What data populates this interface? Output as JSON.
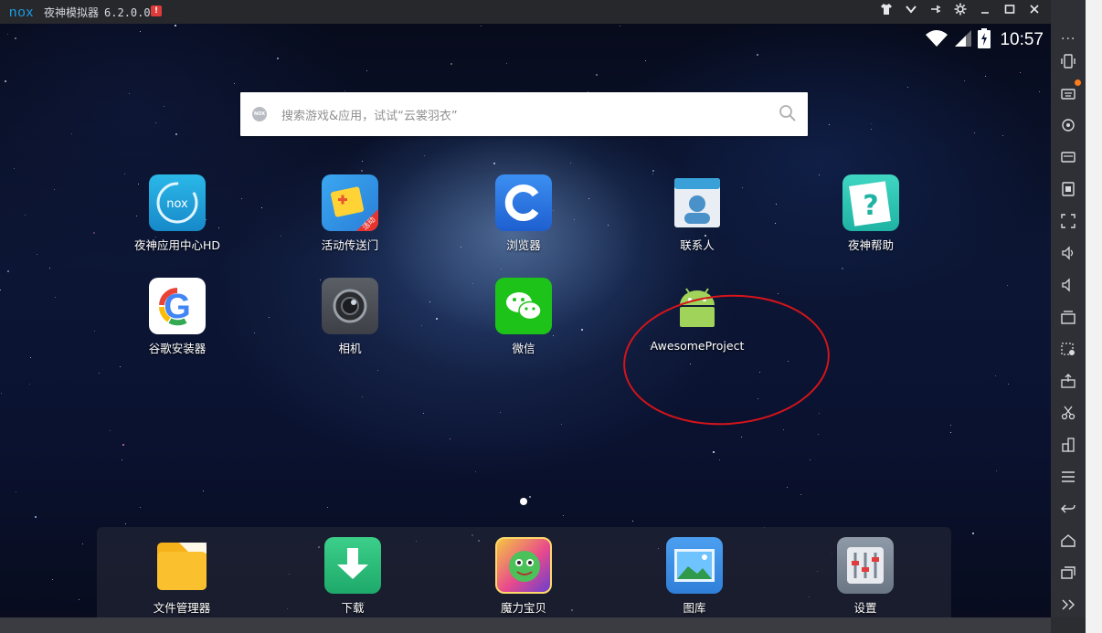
{
  "window": {
    "logo": "nox",
    "title": "夜神模拟器",
    "version": "6.2.0.0",
    "alert_badge": "!",
    "controls": [
      "shirt-icon",
      "chevron-down-icon",
      "pin-icon",
      "gear-icon",
      "minimize-icon",
      "maximize-icon",
      "close-icon"
    ]
  },
  "status": {
    "time": "10:57",
    "icons": [
      "wifi-icon",
      "signal-icon",
      "battery-charging-icon"
    ]
  },
  "search": {
    "badge": "NOX",
    "placeholder": "搜索游戏&应用，试试“云裳羽衣”"
  },
  "apps": [
    {
      "label": "夜神应用中心HD",
      "icon": "nox-app-center-icon"
    },
    {
      "label": "活动传送门",
      "icon": "event-portal-icon",
      "tag": "活动"
    },
    {
      "label": "浏览器",
      "icon": "browser-icon"
    },
    {
      "label": "联系人",
      "icon": "contacts-icon"
    },
    {
      "label": "夜神帮助",
      "icon": "help-icon"
    },
    {
      "label": "谷歌安装器",
      "icon": "google-installer-icon"
    },
    {
      "label": "相机",
      "icon": "camera-icon"
    },
    {
      "label": "微信",
      "icon": "wechat-icon"
    },
    {
      "label": "AwesomeProject",
      "icon": "android-icon"
    }
  ],
  "dock": [
    {
      "label": "文件管理器",
      "icon": "folder-icon"
    },
    {
      "label": "下载",
      "icon": "download-icon"
    },
    {
      "label": "魔力宝贝",
      "icon": "game-icon"
    },
    {
      "label": "图库",
      "icon": "gallery-icon"
    },
    {
      "label": "设置",
      "icon": "settings-icon"
    }
  ],
  "sidebar": {
    "more": "···",
    "tools": [
      "shake-icon",
      "keyboard-icon",
      "location-icon",
      "screen-icon",
      "app-install-icon",
      "fullscreen-icon",
      "volume-up-icon",
      "volume-down-icon",
      "multi-instance-icon",
      "screenshot-icon",
      "apk-icon",
      "scissors-icon",
      "record-icon",
      "menu-icon",
      "back-icon",
      "home-icon",
      "recent-apps-icon",
      "expand-icon"
    ]
  },
  "colors": {
    "accent": "#1d9ee6",
    "annotation": "#d4141a",
    "alert": "#e03b3b"
  }
}
